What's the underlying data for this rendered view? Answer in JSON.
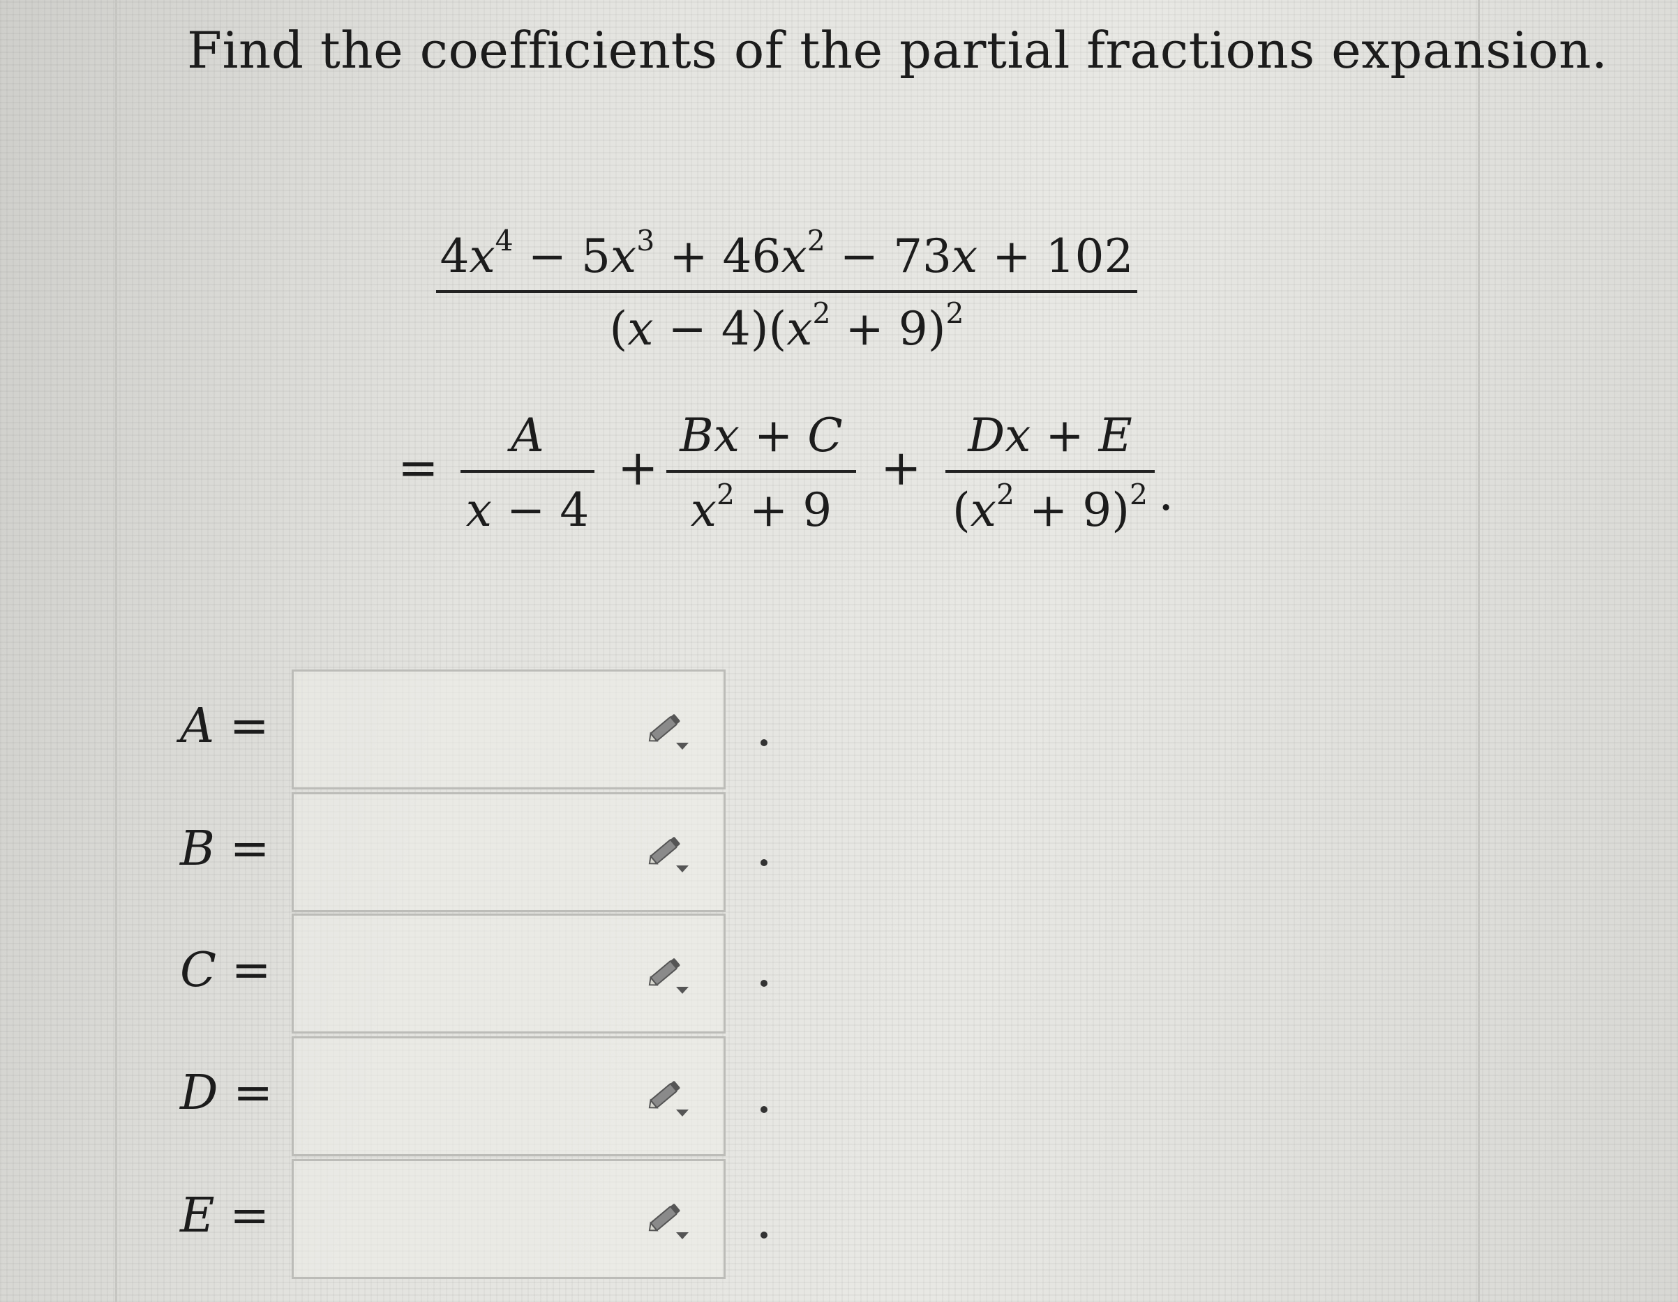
{
  "question": {
    "title": "Find the coefficients of the partial fractions expansion."
  },
  "expression": {
    "numerator": {
      "t1": "4",
      "v1": "x",
      "e1": "4",
      "op1": "−",
      "t2": "5",
      "v2": "x",
      "e2": "3",
      "op2": "+",
      "t3": "46",
      "v3": "x",
      "e3": "2",
      "op3": "−",
      "t4": "73",
      "v4": "x",
      "op4": "+",
      "t5": "102"
    },
    "denominator": {
      "p1": "(",
      "v1": "x",
      "m1": " − 4)(",
      "v2": "x",
      "e2": "2",
      "m2": " + 9)",
      "e3": "2"
    },
    "equals": "=",
    "term1": {
      "num": "A",
      "den_var": "x",
      "den_rest": " − 4"
    },
    "plus1": "+",
    "term2": {
      "num_var1": "B",
      "num_var2": "x",
      "num_rest": " + ",
      "num_var3": "C",
      "den_var": "x",
      "den_exp": "2",
      "den_rest": " + 9"
    },
    "plus2": "+",
    "term3": {
      "num_var1": "D",
      "num_var2": "x",
      "num_rest": " + ",
      "num_var3": "E",
      "den_open": "(",
      "den_var": "x",
      "den_exp": "2",
      "den_rest": " + 9)",
      "den_exp2": "2"
    },
    "period": "."
  },
  "answers": [
    {
      "letter": "A",
      "equals": " =",
      "value": ""
    },
    {
      "letter": "B",
      "equals": " =",
      "value": ""
    },
    {
      "letter": "C",
      "equals": " =",
      "value": ""
    },
    {
      "letter": "D",
      "equals": " =",
      "value": ""
    },
    {
      "letter": "E",
      "equals": " =",
      "value": ""
    }
  ],
  "icons": {
    "answer_tool": "pencil-dropdown-icon"
  },
  "colors": {
    "text": "#1c1c1c",
    "box_border": "#bcbcb8",
    "icon": "#6a6a6a"
  }
}
